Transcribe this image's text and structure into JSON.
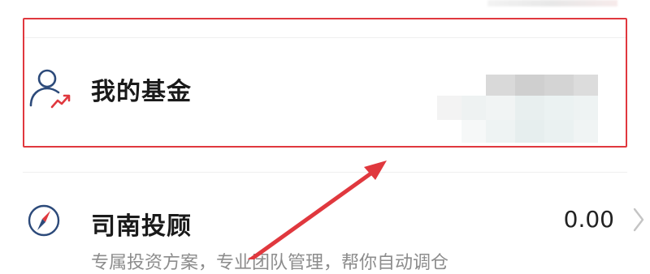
{
  "header": {
    "blurred": true
  },
  "fund_row": {
    "title": "我的基金",
    "icon": "user-chart-icon",
    "highlighted": true,
    "highlight_color": "#e0383e"
  },
  "advisor_row": {
    "title": "司南投顾",
    "value": "0.00",
    "subtitle": "专属投资方案，专业团队管理，帮你自动调仓",
    "icon": "compass-icon",
    "chevron": "chevron-right-icon"
  },
  "annotation": {
    "arrow_color": "#e0383e"
  },
  "colors": {
    "title": "#1a1a1a",
    "subtitle": "#8c8c8c",
    "icon_blue": "#2c4a7a",
    "accent_red": "#e0383e"
  }
}
